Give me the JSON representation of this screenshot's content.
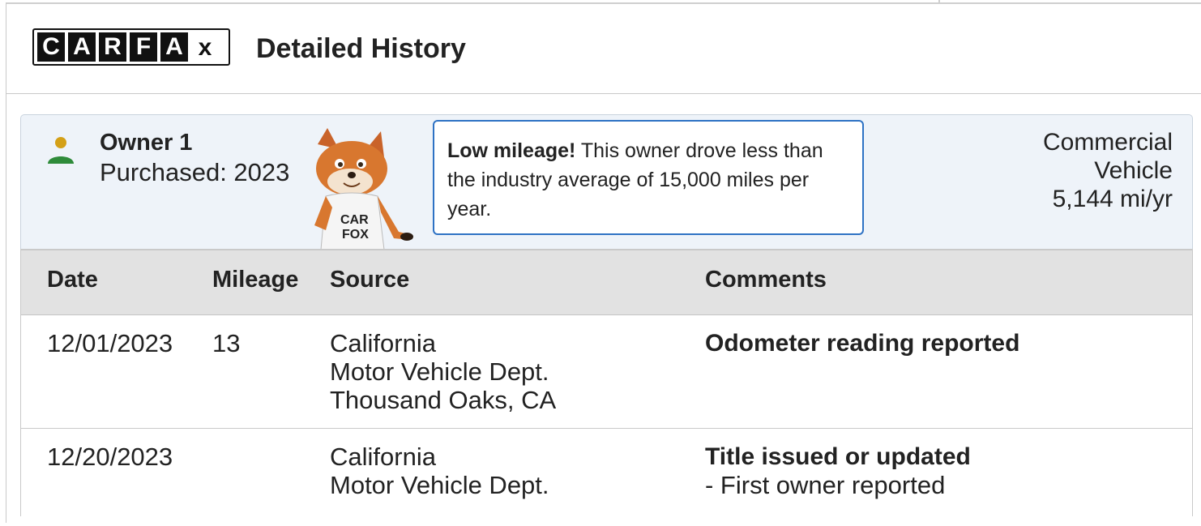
{
  "header": {
    "logo_letters": [
      "C",
      "A",
      "R",
      "F",
      "A",
      "x"
    ],
    "title": "Detailed History"
  },
  "owner": {
    "icon": "person-icon",
    "name": "Owner 1",
    "purchased": "Purchased: 2023",
    "mascot_shirt": "CAR FOX",
    "callout_bold": "Low mileage!",
    "callout_text": " This owner drove less than the industry average of 15,000 miles per year.",
    "usage_type_line1": "Commercial",
    "usage_type_line2": "Vehicle",
    "usage_rate": "5,144 mi/yr"
  },
  "table": {
    "headers": {
      "date": "Date",
      "mileage": "Mileage",
      "source": "Source",
      "comments": "Comments"
    },
    "rows": [
      {
        "date": "12/01/2023",
        "mileage": "13",
        "source": [
          "California",
          "Motor Vehicle Dept.",
          "Thousand Oaks, CA"
        ],
        "comment_title": "Odometer reading reported",
        "comment_detail": ""
      },
      {
        "date": "12/20/2023",
        "mileage": "",
        "source": [
          "California",
          "Motor Vehicle Dept."
        ],
        "comment_title": "Title issued or updated",
        "comment_detail": "- First owner reported"
      }
    ]
  },
  "colors": {
    "owner_panel_bg": "#eef3f9",
    "callout_border": "#2e72c4",
    "table_header_bg": "#e2e2e2",
    "person_head": "#d4a017",
    "person_body": "#2e8b3a"
  }
}
